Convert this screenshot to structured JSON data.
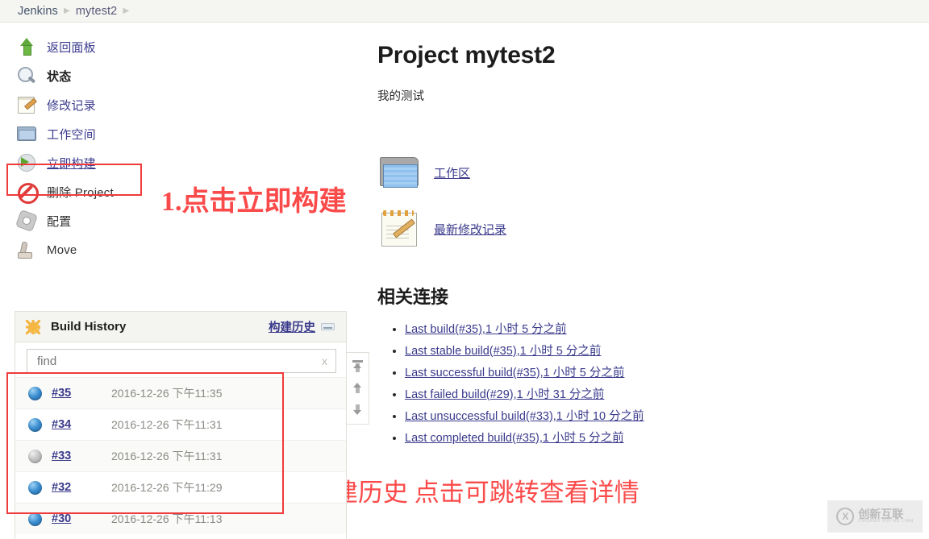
{
  "breadcrumb": {
    "items": [
      {
        "label": "Jenkins"
      },
      {
        "label": "mytest2"
      }
    ]
  },
  "sidebar": {
    "items": [
      {
        "label": "返回面板",
        "icon": "up-arrow-icon"
      },
      {
        "label": "状态",
        "icon": "magnifier-icon"
      },
      {
        "label": "修改记录",
        "icon": "notepad-icon"
      },
      {
        "label": "工作空间",
        "icon": "folder-icon"
      },
      {
        "label": "立即构建",
        "icon": "build-now-icon"
      },
      {
        "label": "删除 Project",
        "icon": "delete-icon"
      },
      {
        "label": "配置",
        "icon": "gear-icon"
      },
      {
        "label": "Move",
        "icon": "move-icon"
      }
    ]
  },
  "annotations": {
    "build_now": "1.点击立即构建",
    "build_history": "构建历史 点击可跳转查看详情"
  },
  "build_history": {
    "title": "Build History",
    "link_label": "构建历史",
    "trend_icon": "trend-icon",
    "find_value": "",
    "find_placeholder": "find",
    "clear_label": "x",
    "scroll_buttons": [
      {
        "name": "scroll-to-top"
      },
      {
        "name": "scroll-up"
      },
      {
        "name": "scroll-down"
      }
    ],
    "rows": [
      {
        "number": "#35",
        "time": "2016-12-26 下午11:35",
        "status": "blue"
      },
      {
        "number": "#34",
        "time": "2016-12-26 下午11:31",
        "status": "blue"
      },
      {
        "number": "#33",
        "time": "2016-12-26 下午11:31",
        "status": "grey"
      },
      {
        "number": "#32",
        "time": "2016-12-26 下午11:29",
        "status": "blue"
      },
      {
        "number": "#30",
        "time": "2016-12-26 下午11:13",
        "status": "blue"
      }
    ]
  },
  "main": {
    "title": "Project mytest2",
    "description": "我的测试",
    "big_links": [
      {
        "label": "工作区",
        "icon": "workspace-folder-icon"
      },
      {
        "label": "最新修改记录",
        "icon": "changes-notepad-icon"
      }
    ],
    "section_title": "相关连接",
    "related_links": [
      {
        "label": "Last build(#35),1 小时 5 分之前"
      },
      {
        "label": "Last stable build(#35),1 小时 5 分之前"
      },
      {
        "label": "Last successful build(#35),1 小时 5 分之前"
      },
      {
        "label": "Last failed build(#29),1 小时 31 分之前"
      },
      {
        "label": "Last unsuccessful build(#33),1 小时 10 分之前"
      },
      {
        "label": "Last completed build(#35),1 小时 5 分之前"
      }
    ]
  },
  "watermark": {
    "mark": "X",
    "cn": "创新互联",
    "en": "CHUANG XIN HU LIAN"
  },
  "colors": {
    "link": "#3a3a8c",
    "annotation_red": "#fb4a4a",
    "highlight_red": "#ef3b3b",
    "breadcrumb_bg": "#f5f5f2"
  }
}
